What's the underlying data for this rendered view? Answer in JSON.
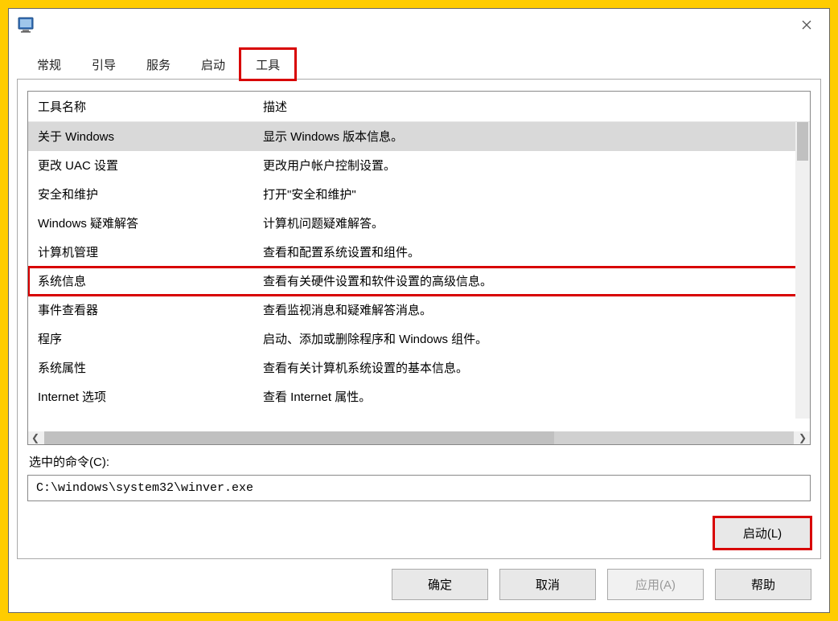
{
  "tabs": {
    "general": "常规",
    "boot": "引导",
    "services": "服务",
    "startup": "启动",
    "tools": "工具"
  },
  "columns": {
    "name": "工具名称",
    "desc": "描述"
  },
  "rows": [
    {
      "name": "关于 Windows",
      "desc": "显示 Windows 版本信息。",
      "selected": true
    },
    {
      "name": "更改 UAC 设置",
      "desc": "更改用户帐户控制设置。"
    },
    {
      "name": "安全和维护",
      "desc": "打开\"安全和维护\""
    },
    {
      "name": "Windows 疑难解答",
      "desc": "计算机问题疑难解答。"
    },
    {
      "name": "计算机管理",
      "desc": "查看和配置系统设置和组件。"
    },
    {
      "name": "系统信息",
      "desc": "查看有关硬件设置和软件设置的高级信息。",
      "highlight": true
    },
    {
      "name": "事件查看器",
      "desc": "查看监视消息和疑难解答消息。"
    },
    {
      "name": "程序",
      "desc": "启动、添加或删除程序和 Windows 组件。"
    },
    {
      "name": "系统属性",
      "desc": "查看有关计算机系统设置的基本信息。"
    },
    {
      "name": "Internet 选项",
      "desc": "查看 Internet 属性。"
    }
  ],
  "selected_command": {
    "label": "选中的命令(C):",
    "value": "C:\\windows\\system32\\winver.exe"
  },
  "buttons": {
    "launch": "启动(L)",
    "ok": "确定",
    "cancel": "取消",
    "apply": "应用(A)",
    "help": "帮助"
  }
}
